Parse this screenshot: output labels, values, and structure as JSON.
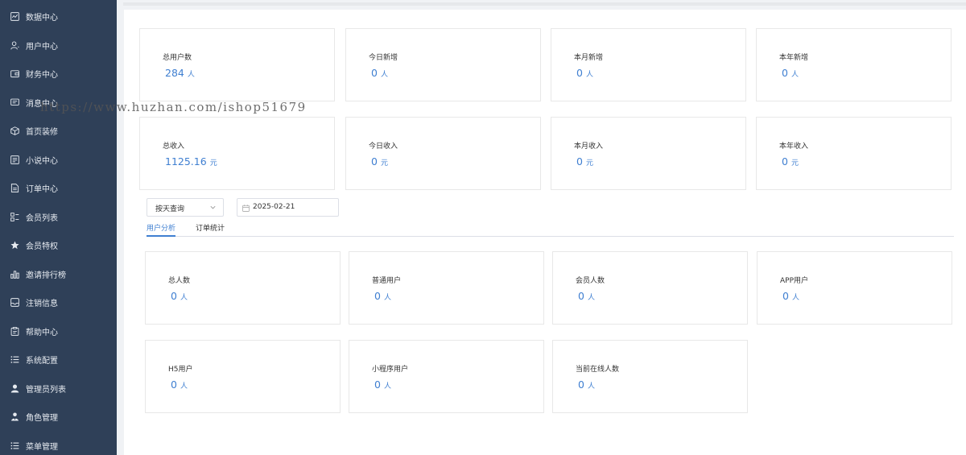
{
  "sidebar": {
    "items": [
      {
        "label": "数据中心",
        "icon": "chart-icon"
      },
      {
        "label": "用户中心",
        "icon": "user-icon"
      },
      {
        "label": "财务中心",
        "icon": "wallet-icon"
      },
      {
        "label": "消息中心",
        "icon": "message-icon"
      },
      {
        "label": "首页装修",
        "icon": "box-icon"
      },
      {
        "label": "小说中心",
        "icon": "book-icon"
      },
      {
        "label": "订单中心",
        "icon": "document-icon"
      },
      {
        "label": "会员列表",
        "icon": "grid-list-icon"
      },
      {
        "label": "会员特权",
        "icon": "star-icon"
      },
      {
        "label": "邀请排行榜",
        "icon": "bar-chart-icon"
      },
      {
        "label": "注销信息",
        "icon": "inbox-icon"
      },
      {
        "label": "帮助中心",
        "icon": "clipboard-icon"
      },
      {
        "label": "系统配置",
        "icon": "list-icon"
      },
      {
        "label": "管理员列表",
        "icon": "person-icon"
      },
      {
        "label": "角色管理",
        "icon": "role-icon"
      },
      {
        "label": "菜单管理",
        "icon": "menu-list-icon"
      }
    ]
  },
  "watermark": "https://www.huzhan.com/ishop51679",
  "summary_cards": [
    {
      "label": "总用户数",
      "value": "284",
      "unit": "人"
    },
    {
      "label": "今日新增",
      "value": "0",
      "unit": "人"
    },
    {
      "label": "本月新增",
      "value": "0",
      "unit": "人"
    },
    {
      "label": "本年新增",
      "value": "0",
      "unit": "人"
    },
    {
      "label": "总收入",
      "value": "1125.16",
      "unit": "元"
    },
    {
      "label": "今日收入",
      "value": "0",
      "unit": "元"
    },
    {
      "label": "本月收入",
      "value": "0",
      "unit": "元"
    },
    {
      "label": "本年收入",
      "value": "0",
      "unit": "元"
    }
  ],
  "filters": {
    "query_mode": "按天查询",
    "date": "2025-02-21"
  },
  "tabs": [
    {
      "label": "用户分析",
      "active": true
    },
    {
      "label": "订单统计",
      "active": false
    }
  ],
  "user_cards": [
    {
      "label": "总人数",
      "value": "0",
      "unit": "人"
    },
    {
      "label": "普通用户",
      "value": "0",
      "unit": "人"
    },
    {
      "label": "会员人数",
      "value": "0",
      "unit": "人"
    },
    {
      "label": "APP用户",
      "value": "0",
      "unit": "人"
    },
    {
      "label": "H5用户",
      "value": "0",
      "unit": "人"
    },
    {
      "label": "小程序用户",
      "value": "0",
      "unit": "人"
    },
    {
      "label": "当前在线人数",
      "value": "0",
      "unit": "人"
    }
  ],
  "colors": {
    "sidebar_bg": "#2f4058",
    "accent": "#3f7fd1"
  }
}
